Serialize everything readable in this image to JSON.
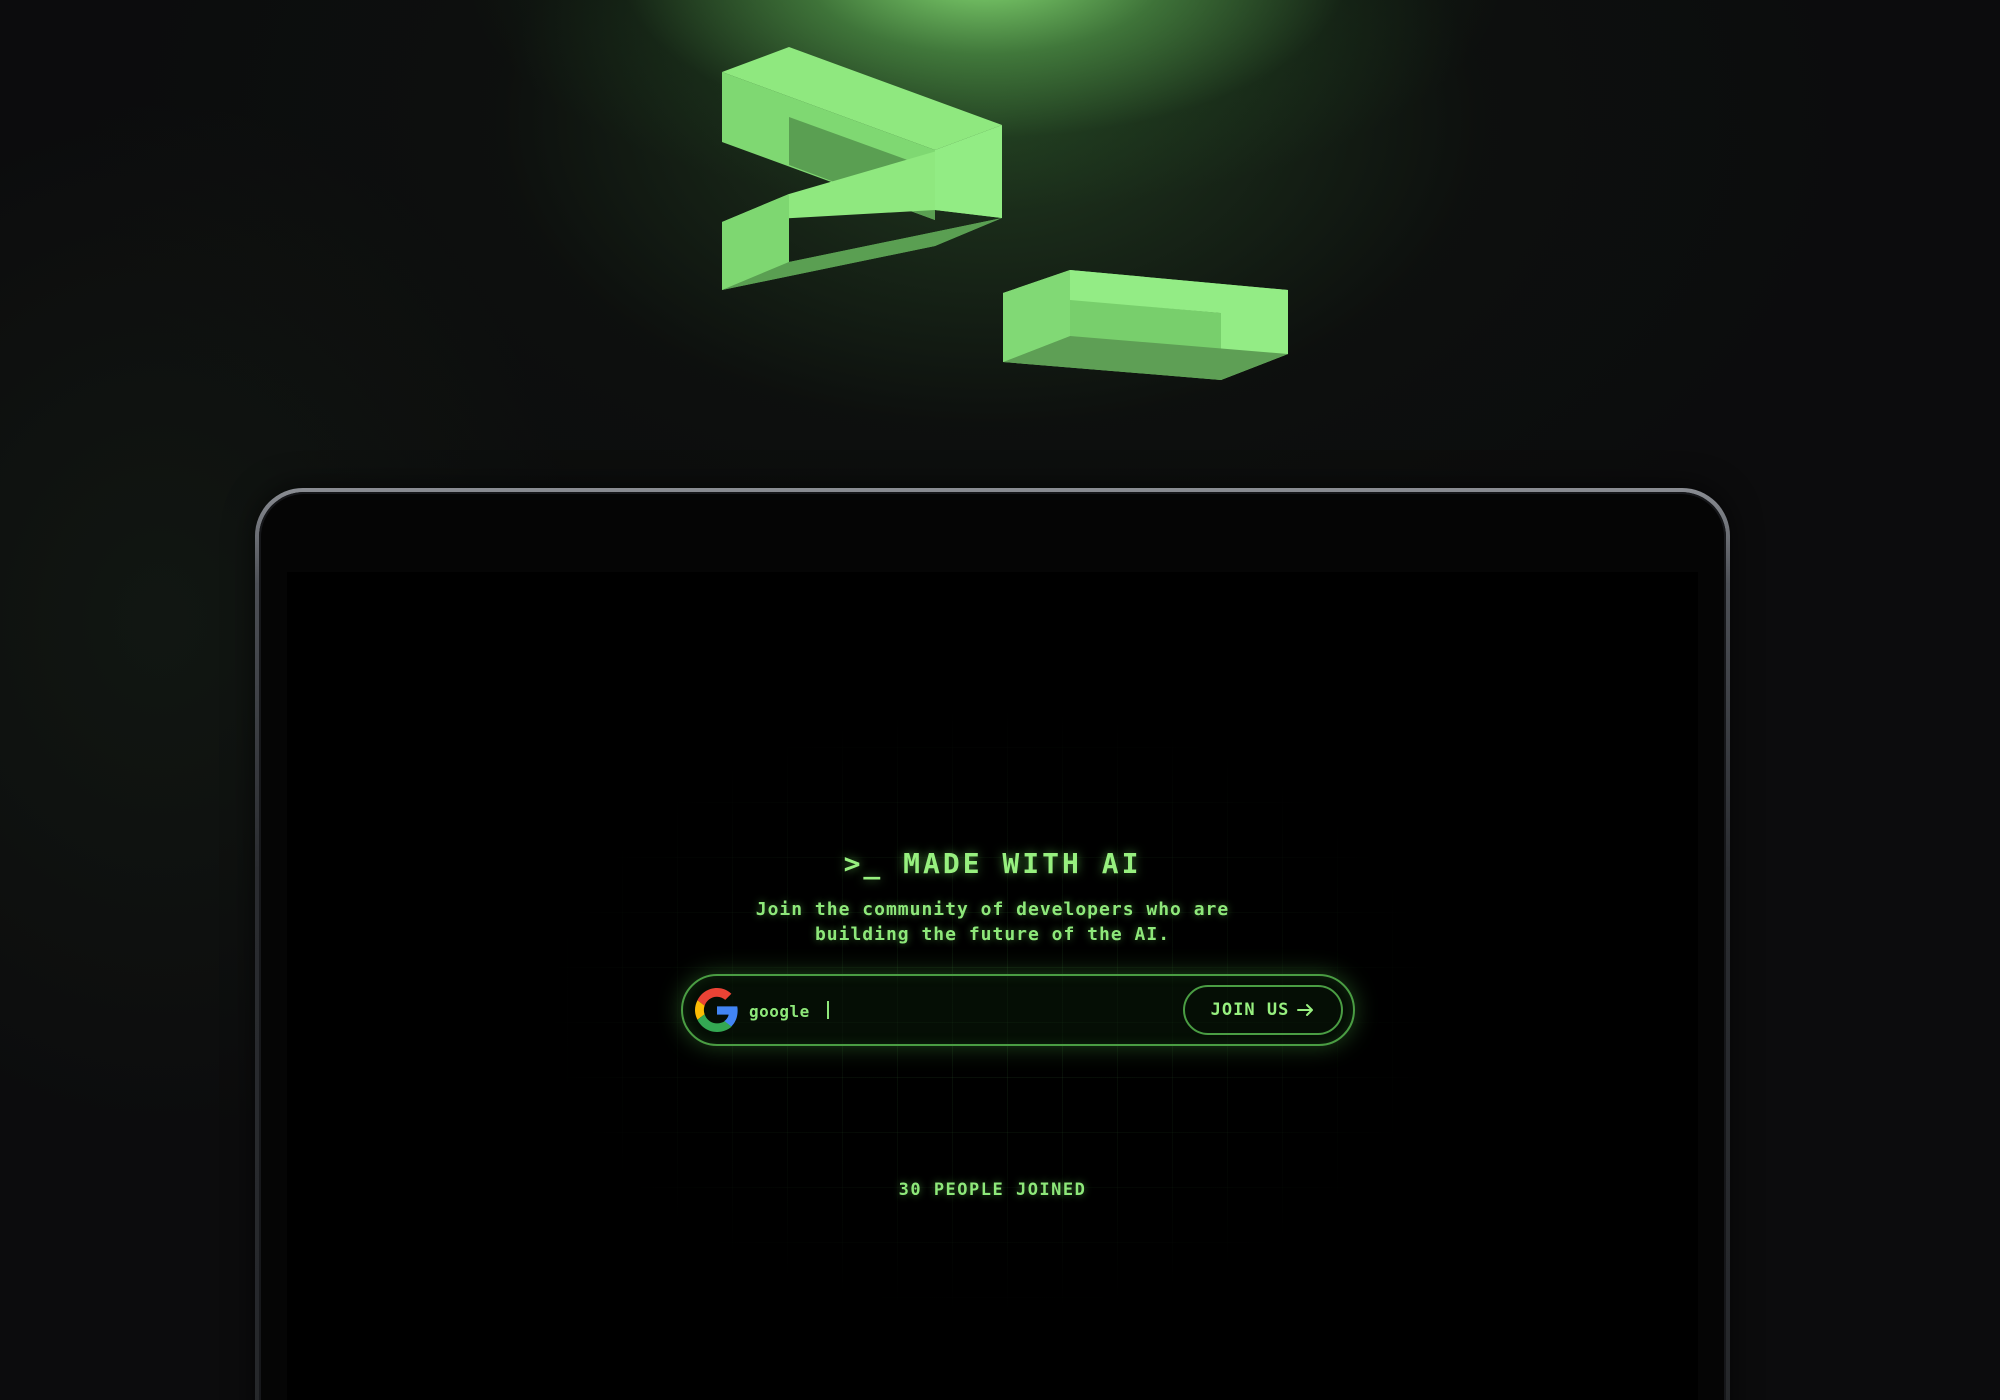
{
  "hero": {
    "logo_icon": "terminal-prompt-icon",
    "accent_color": "#94EE86"
  },
  "screen": {
    "headline": ">_ MADE WITH AI",
    "subtitle_line1": "Join the community of developers who are",
    "subtitle_line2": "building the future of the AI.",
    "join_form": {
      "provider_icon": "google-icon",
      "input_value": "google",
      "button_label": "JOIN US",
      "button_icon": "arrow-right-icon"
    },
    "joined_count_text": "30 PEOPLE JOINED"
  }
}
